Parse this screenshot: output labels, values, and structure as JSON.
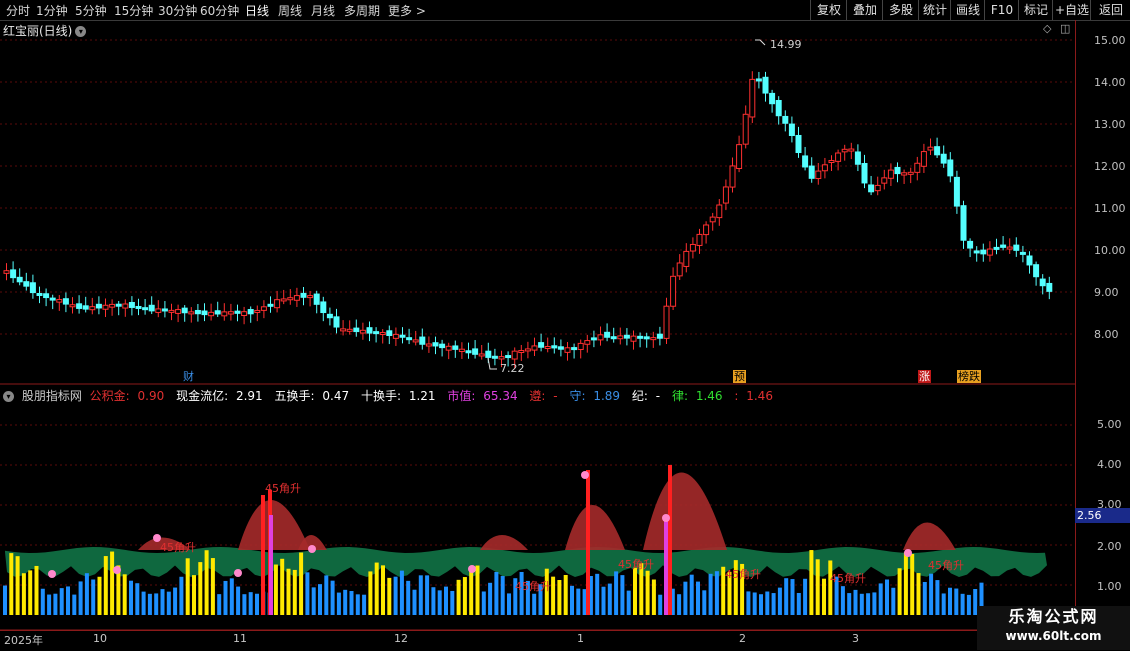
{
  "toolbar": {
    "periods": [
      "分时",
      "1分钟",
      "5分钟",
      "15分钟",
      "30分钟",
      "60分钟",
      "日线",
      "周线",
      "月线",
      "多周期",
      "更多 >"
    ],
    "active_period": "日线",
    "right_buttons": [
      "复权",
      "叠加",
      "多股",
      "统计",
      "画线",
      "F10",
      "标记",
      "+自选",
      "返回"
    ]
  },
  "chart": {
    "stock_title": "红宝丽(日线)",
    "price_axis": [
      "15.00",
      "14.00",
      "13.00",
      "12.00",
      "11.00",
      "10.00",
      "9.00",
      "8.00"
    ],
    "high_label": "14.99",
    "low_label": "7.22",
    "badges": [
      {
        "text": "财",
        "color": "#3a8ee6",
        "bg": "transparent"
      },
      {
        "text": "预",
        "color": "#000",
        "bg": "#e8a020"
      },
      {
        "text": "涨",
        "color": "#fff",
        "bg": "#c01818"
      },
      {
        "text": "榜跌",
        "color": "#000",
        "bg": "#e8a020"
      }
    ]
  },
  "indicator": {
    "name": "股朋指标网",
    "fields": [
      {
        "label": "公积金:",
        "value": "0.90",
        "color": "#e03030"
      },
      {
        "label": "现金流亿:",
        "value": "2.91",
        "color": "#ffffff"
      },
      {
        "label": "五换手:",
        "value": "0.47",
        "color": "#ffffff"
      },
      {
        "label": "十换手:",
        "value": "1.21",
        "color": "#ffffff"
      },
      {
        "label": "市值:",
        "value": "65.34",
        "color": "#e040e0"
      },
      {
        "label": "遵:",
        "value": "-",
        "color": "#e03030"
      },
      {
        "label": "守:",
        "value": "1.89",
        "color": "#3a8ee6"
      },
      {
        "label": "纪:",
        "value": "-",
        "color": "#ffffff"
      },
      {
        "label": "律:",
        "value": "1.46",
        "color": "#30e030"
      },
      {
        "label": ":",
        "value": "1.46",
        "color": "#e03030"
      }
    ],
    "axis": [
      "5.00",
      "4.00",
      "3.00",
      "2.00",
      "1.00"
    ],
    "current_value": "2.56",
    "annotation": "45角升"
  },
  "dates": [
    "2025年",
    "10",
    "11",
    "12",
    "1",
    "2",
    "3"
  ],
  "watermark": {
    "line1": "乐淘公式网",
    "line2": "www.60lt.com"
  },
  "colors": {
    "up": "#ff3030",
    "down": "#54ffff",
    "grid": "#5a0a0a",
    "axis": "#8b1a1a"
  }
}
